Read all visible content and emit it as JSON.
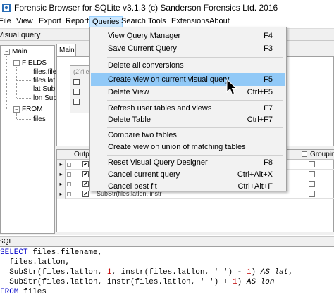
{
  "window": {
    "title": "Forensic Browser for SQLite v3.1.3 (c) Sanderson Forensics Ltd. 2016"
  },
  "menubar": {
    "items": [
      "File",
      "View",
      "Export",
      "Report",
      "Queries",
      "Search",
      "Tools",
      "Extensions",
      "About"
    ],
    "active": "Queries"
  },
  "toolbar": {
    "label": "Visual query"
  },
  "tree": {
    "root": "Main",
    "fields_label": "FIELDS",
    "fields": [
      "files.file",
      "files.lat",
      "lat Sub",
      "lon Sub"
    ],
    "from_label": "FROM",
    "from": [
      "files"
    ]
  },
  "tabs": {
    "main": "Main"
  },
  "tablebox": {
    "header": "(2)file"
  },
  "grid": {
    "col_output": "Outpu",
    "col_grouping": "Grouping",
    "rows": [
      {
        "selector": "▸",
        "expr": ""
      },
      {
        "selector": "▸",
        "expr": ""
      },
      {
        "selector": "▸",
        "expr": ""
      },
      {
        "selector": "▸",
        "expr": "SubStr(files.latlon, instr"
      }
    ]
  },
  "sql": {
    "label": "SQL",
    "select_kw": "SELECT",
    "line1_rest": " files.filename,",
    "line2": "  files.latlon,",
    "line3_a": "  SubStr(files.latlon, ",
    "line3_num1": "1",
    "line3_b": ", instr(files.latlon, ' ') - ",
    "line3_num2": "1",
    "line3_c": ") ",
    "line3_as": "AS lat",
    "line3_d": ",",
    "line4_a": "  SubStr(files.latlon, instr(files.latlon, ' ') + ",
    "line4_num": "1",
    "line4_b": ") ",
    "line4_as": "AS lon",
    "from_kw": "FROM",
    "line5_rest": " files"
  },
  "menu_queries": {
    "items": [
      {
        "label": "View Query Manager",
        "shortcut": "F4"
      },
      {
        "label": "Save Current Query",
        "shortcut": "F3"
      },
      {
        "label": "Delete all conversions",
        "shortcut": ""
      },
      {
        "label": "Create view on current visual query",
        "shortcut": "F5"
      },
      {
        "label": "Delete View",
        "shortcut": "Ctrl+F5"
      },
      {
        "label": "Refresh user tables and views",
        "shortcut": "F7"
      },
      {
        "label": "Delete Table",
        "shortcut": "Ctrl+F7"
      },
      {
        "label": "Compare two tables",
        "shortcut": ""
      },
      {
        "label": "Create view on union of matching tables",
        "shortcut": ""
      },
      {
        "label": "Reset Visual Query Designer",
        "shortcut": "F8"
      },
      {
        "label": "Cancel current query",
        "shortcut": "Ctrl+Alt+X"
      },
      {
        "label": "Cancel best fit",
        "shortcut": "Ctrl+Alt+F"
      }
    ],
    "highlighted_index": 3
  },
  "colors": {
    "menu_highlight": "#91c9f7",
    "menubar_active": "#cce8ff",
    "sql_keyword": "#0000c8",
    "sql_number": "#c00000"
  }
}
